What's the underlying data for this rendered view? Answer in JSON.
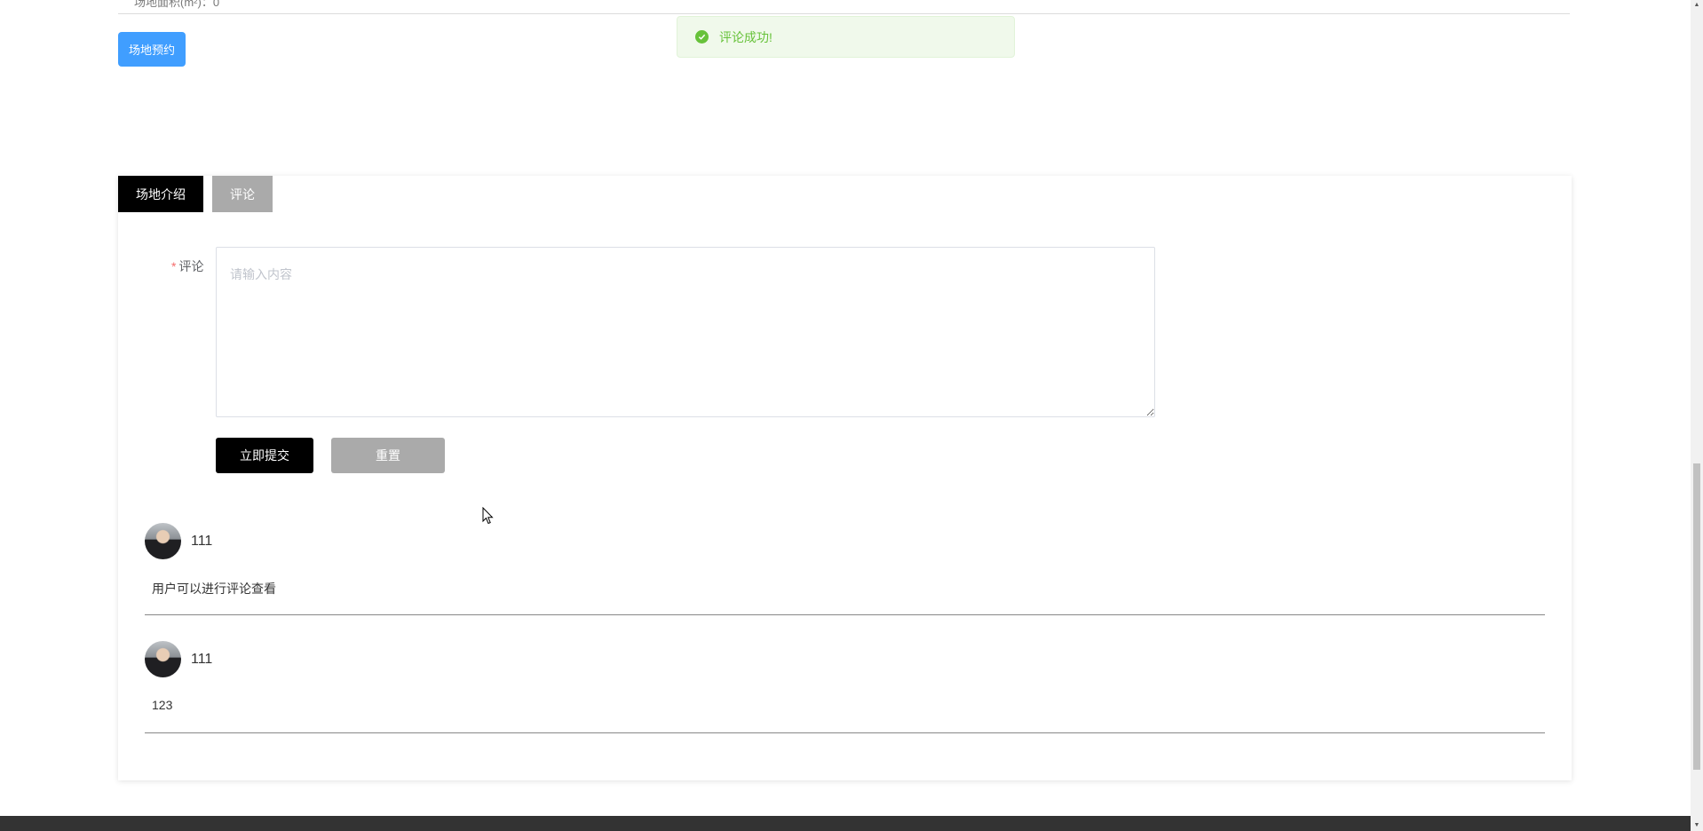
{
  "top_partial_text": "场地面积(m²)：0",
  "book_button_label": "场地预约",
  "toast": {
    "message": "评论成功!",
    "color": "#67c23a"
  },
  "tabs": [
    {
      "label": "场地介绍"
    },
    {
      "label": "评论"
    }
  ],
  "comment_form": {
    "label": "评论",
    "required_mark": "*",
    "placeholder": "请输入内容",
    "value": "",
    "submit_label": "立即提交",
    "reset_label": "重置"
  },
  "comments": [
    {
      "user": "111",
      "text": "用户可以进行评论查看"
    },
    {
      "user": "111",
      "text": "123"
    }
  ],
  "colors": {
    "primary": "#409eff",
    "success": "#67c23a",
    "black": "#000000",
    "gray_button": "#aaaaaa"
  }
}
